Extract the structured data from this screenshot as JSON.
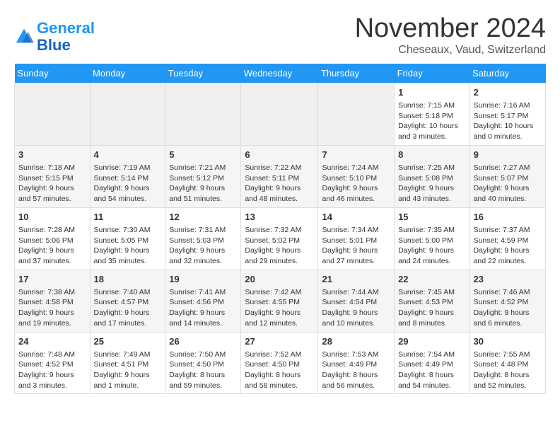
{
  "header": {
    "logo_line1": "General",
    "logo_line2": "Blue",
    "month": "November 2024",
    "location": "Cheseaux, Vaud, Switzerland"
  },
  "weekdays": [
    "Sunday",
    "Monday",
    "Tuesday",
    "Wednesday",
    "Thursday",
    "Friday",
    "Saturday"
  ],
  "weeks": [
    [
      {
        "day": "",
        "info": ""
      },
      {
        "day": "",
        "info": ""
      },
      {
        "day": "",
        "info": ""
      },
      {
        "day": "",
        "info": ""
      },
      {
        "day": "",
        "info": ""
      },
      {
        "day": "1",
        "info": "Sunrise: 7:15 AM\nSunset: 5:18 PM\nDaylight: 10 hours and 3 minutes."
      },
      {
        "day": "2",
        "info": "Sunrise: 7:16 AM\nSunset: 5:17 PM\nDaylight: 10 hours and 0 minutes."
      }
    ],
    [
      {
        "day": "3",
        "info": "Sunrise: 7:18 AM\nSunset: 5:15 PM\nDaylight: 9 hours and 57 minutes."
      },
      {
        "day": "4",
        "info": "Sunrise: 7:19 AM\nSunset: 5:14 PM\nDaylight: 9 hours and 54 minutes."
      },
      {
        "day": "5",
        "info": "Sunrise: 7:21 AM\nSunset: 5:12 PM\nDaylight: 9 hours and 51 minutes."
      },
      {
        "day": "6",
        "info": "Sunrise: 7:22 AM\nSunset: 5:11 PM\nDaylight: 9 hours and 48 minutes."
      },
      {
        "day": "7",
        "info": "Sunrise: 7:24 AM\nSunset: 5:10 PM\nDaylight: 9 hours and 46 minutes."
      },
      {
        "day": "8",
        "info": "Sunrise: 7:25 AM\nSunset: 5:08 PM\nDaylight: 9 hours and 43 minutes."
      },
      {
        "day": "9",
        "info": "Sunrise: 7:27 AM\nSunset: 5:07 PM\nDaylight: 9 hours and 40 minutes."
      }
    ],
    [
      {
        "day": "10",
        "info": "Sunrise: 7:28 AM\nSunset: 5:06 PM\nDaylight: 9 hours and 37 minutes."
      },
      {
        "day": "11",
        "info": "Sunrise: 7:30 AM\nSunset: 5:05 PM\nDaylight: 9 hours and 35 minutes."
      },
      {
        "day": "12",
        "info": "Sunrise: 7:31 AM\nSunset: 5:03 PM\nDaylight: 9 hours and 32 minutes."
      },
      {
        "day": "13",
        "info": "Sunrise: 7:32 AM\nSunset: 5:02 PM\nDaylight: 9 hours and 29 minutes."
      },
      {
        "day": "14",
        "info": "Sunrise: 7:34 AM\nSunset: 5:01 PM\nDaylight: 9 hours and 27 minutes."
      },
      {
        "day": "15",
        "info": "Sunrise: 7:35 AM\nSunset: 5:00 PM\nDaylight: 9 hours and 24 minutes."
      },
      {
        "day": "16",
        "info": "Sunrise: 7:37 AM\nSunset: 4:59 PM\nDaylight: 9 hours and 22 minutes."
      }
    ],
    [
      {
        "day": "17",
        "info": "Sunrise: 7:38 AM\nSunset: 4:58 PM\nDaylight: 9 hours and 19 minutes."
      },
      {
        "day": "18",
        "info": "Sunrise: 7:40 AM\nSunset: 4:57 PM\nDaylight: 9 hours and 17 minutes."
      },
      {
        "day": "19",
        "info": "Sunrise: 7:41 AM\nSunset: 4:56 PM\nDaylight: 9 hours and 14 minutes."
      },
      {
        "day": "20",
        "info": "Sunrise: 7:42 AM\nSunset: 4:55 PM\nDaylight: 9 hours and 12 minutes."
      },
      {
        "day": "21",
        "info": "Sunrise: 7:44 AM\nSunset: 4:54 PM\nDaylight: 9 hours and 10 minutes."
      },
      {
        "day": "22",
        "info": "Sunrise: 7:45 AM\nSunset: 4:53 PM\nDaylight: 9 hours and 8 minutes."
      },
      {
        "day": "23",
        "info": "Sunrise: 7:46 AM\nSunset: 4:52 PM\nDaylight: 9 hours and 6 minutes."
      }
    ],
    [
      {
        "day": "24",
        "info": "Sunrise: 7:48 AM\nSunset: 4:52 PM\nDaylight: 9 hours and 3 minutes."
      },
      {
        "day": "25",
        "info": "Sunrise: 7:49 AM\nSunset: 4:51 PM\nDaylight: 9 hours and 1 minute."
      },
      {
        "day": "26",
        "info": "Sunrise: 7:50 AM\nSunset: 4:50 PM\nDaylight: 8 hours and 59 minutes."
      },
      {
        "day": "27",
        "info": "Sunrise: 7:52 AM\nSunset: 4:50 PM\nDaylight: 8 hours and 58 minutes."
      },
      {
        "day": "28",
        "info": "Sunrise: 7:53 AM\nSunset: 4:49 PM\nDaylight: 8 hours and 56 minutes."
      },
      {
        "day": "29",
        "info": "Sunrise: 7:54 AM\nSunset: 4:49 PM\nDaylight: 8 hours and 54 minutes."
      },
      {
        "day": "30",
        "info": "Sunrise: 7:55 AM\nSunset: 4:48 PM\nDaylight: 8 hours and 52 minutes."
      }
    ]
  ]
}
